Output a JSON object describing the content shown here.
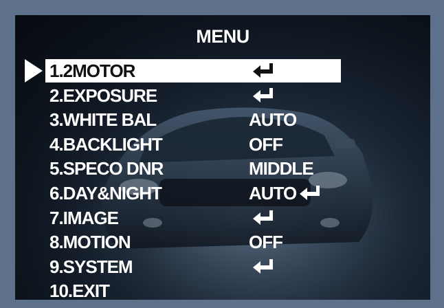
{
  "menu": {
    "title": "MENU",
    "items": [
      {
        "label": "1.2MOTOR",
        "value": "",
        "enter": true
      },
      {
        "label": "2.EXPOSURE",
        "value": "",
        "enter": true
      },
      {
        "label": "3.WHITE BAL",
        "value": "AUTO",
        "enter": false
      },
      {
        "label": "4.BACKLIGHT",
        "value": "OFF",
        "enter": false
      },
      {
        "label": "5.SPECO DNR",
        "value": "MIDDLE",
        "enter": false
      },
      {
        "label": "6.DAY&NIGHT",
        "value": "AUTO",
        "enter": true
      },
      {
        "label": "7.IMAGE",
        "value": "",
        "enter": true
      },
      {
        "label": "8.MOTION",
        "value": "OFF",
        "enter": false
      },
      {
        "label": "9.SYSTEM",
        "value": "",
        "enter": true
      },
      {
        "label": "10.EXIT",
        "value": "",
        "enter": false
      }
    ]
  },
  "icons": {
    "pointer": "selection-arrow-icon",
    "enter": "enter-return-icon"
  },
  "colors": {
    "frame": "#5d718a",
    "text": "#ffffff",
    "highlight": "#ffffff",
    "highlight_text": "#111111"
  }
}
